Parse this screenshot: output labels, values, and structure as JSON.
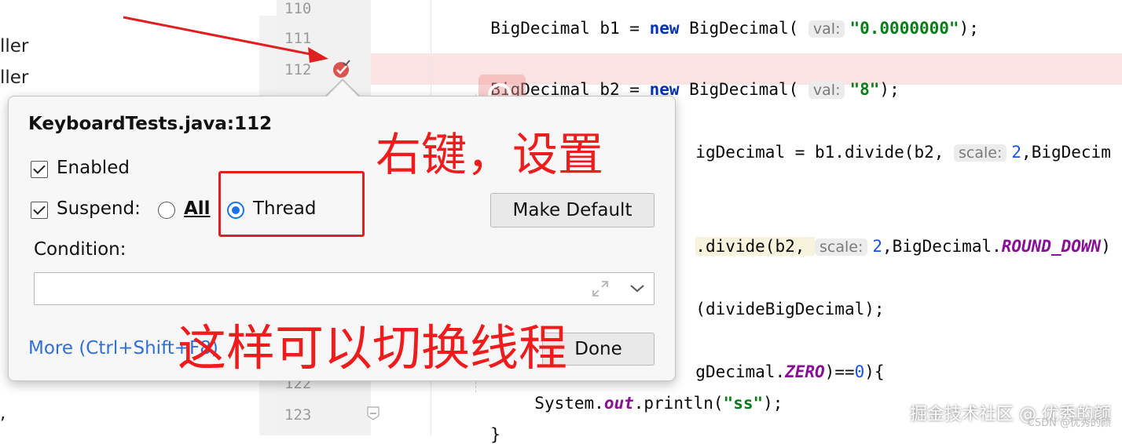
{
  "tree": {
    "items": [
      "ller",
      "ller",
      ","
    ]
  },
  "gutter": {
    "line_numbers": [
      "110",
      "111",
      "112",
      "122",
      "123"
    ]
  },
  "editor": {
    "line110": {
      "prefix": "BigDecimal b1 = ",
      "kw": "new",
      "cls": " BigDecimal(",
      "hint": "val:",
      "str": "\"0.0000000\"",
      "suffix": ");"
    },
    "line112": {
      "prefix": "BigDecimal b2 = ",
      "kw": "new",
      "cls": " BigDecimal(",
      "hint": "val:",
      "str": "\"8\"",
      "suffix": ");"
    },
    "line114": {
      "prefix": "igDecimal = b1.divide(b2, ",
      "hint": "scale:",
      "num": "2",
      "suffix": ",BigDecim"
    },
    "line116": {
      "prefix": ".divide(b2, ",
      "hint": "scale:",
      "num": "2",
      "mid": ",BigDecimal.",
      "const": "ROUND_DOWN",
      "suffix": ")"
    },
    "line118": {
      "text": "(divideBigDecimal);"
    },
    "line120": {
      "prefix": "gDecimal.",
      "const": "ZERO",
      "mid": ")==",
      "num": "0",
      "suffix": "){"
    },
    "line122": {
      "prefix": "System.",
      "const": "out",
      "mid": ".println(",
      "str": "\"ss\"",
      "suffix": ");"
    },
    "line123": {
      "text": "}"
    }
  },
  "popup": {
    "title": "KeyboardTests.java:112",
    "enabled_label": "Enabled",
    "suspend_label": "Suspend:",
    "all_label": "All",
    "thread_label": "Thread",
    "make_default_label": "Make Default",
    "condition_label": "Condition:",
    "condition_value": "",
    "more_link": "More (Ctrl+Shift+F8)",
    "done_label": "Done"
  },
  "annotations": {
    "right_click_text": "右键，设置",
    "switch_thread_text": "这样可以切换线程"
  },
  "watermark": {
    "text": "掘金技术社区 @ 优秀的颜",
    "sub": "CSDN @优秀的颜"
  },
  "colors": {
    "annotation_red": "#ee1c1c",
    "link_blue": "#2f6fd6",
    "radio_blue": "#1a73e8",
    "breakpoint_line_bg": "#fbe3e3"
  }
}
